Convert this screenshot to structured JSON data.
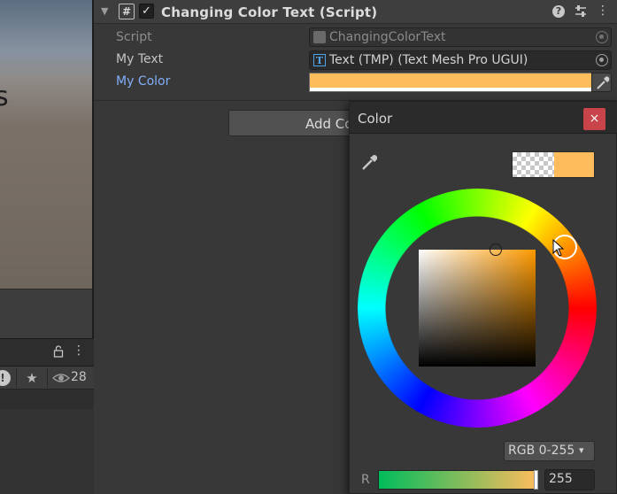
{
  "scene": {
    "glyph": "s"
  },
  "project_panel": {
    "hidden_packages_count": "28",
    "icons": [
      "lock-icon",
      "kebab-menu-icon",
      "warning-icon",
      "star-icon",
      "eye-icon"
    ]
  },
  "component": {
    "title": "Changing Color Text (Script)",
    "enabled": true,
    "icons": {
      "script": "#",
      "enabled_check": "✓",
      "help": "?",
      "presets": "⇌",
      "menu": "⋮"
    },
    "fold_arrow": "▼"
  },
  "properties": {
    "script": {
      "label": "Script",
      "value": "ChangingColorText"
    },
    "my_text": {
      "label": "My Text",
      "value": "Text (TMP) (Text Mesh Pro UGUI)",
      "icon_glyph": "T"
    },
    "my_color": {
      "label": "My Color",
      "value_color": "#ffbc5c",
      "alpha": 1.0
    }
  },
  "add_component_button": {
    "label": "Add Component"
  },
  "color_popup": {
    "title": "Color",
    "close_glyph": "×",
    "current_color": "#ffbc5c",
    "mode": "RGB 0-255",
    "mode_chevron": "▾",
    "hue_degrees": 35,
    "saturation": 0.64,
    "value": 1.0,
    "channels": [
      {
        "label": "R",
        "value": "255",
        "fraction": 1.0
      }
    ]
  },
  "colors": {
    "accent_label": "#80aef7",
    "close_button": "#c9434a",
    "panel_bg": "#383838",
    "header_bg": "#3e3e3e"
  }
}
